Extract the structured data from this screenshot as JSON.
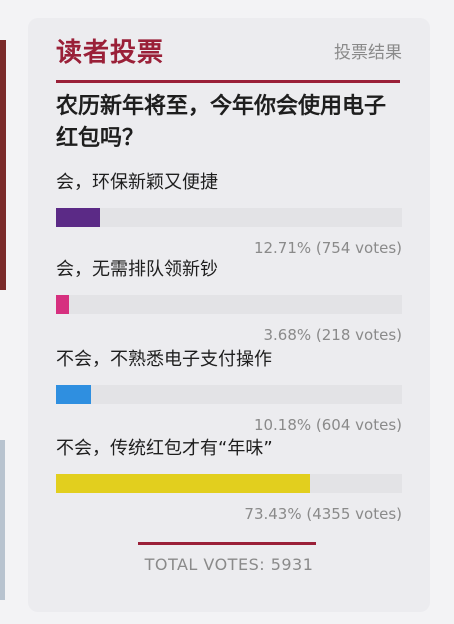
{
  "header": {
    "title": "读者投票",
    "results_link": "投票结果"
  },
  "question": "农历新年将至，今年你会使用电子红包吗？",
  "options": [
    {
      "label": "会，环保新颖又便捷",
      "percent": 12.71,
      "result_text": "12.71% (754 votes)",
      "color": "#5b2a86"
    },
    {
      "label": "会，无需排队领新钞",
      "percent": 3.68,
      "result_text": "3.68% (218 votes)",
      "color": "#d6307f"
    },
    {
      "label": "不会，不熟悉电子支付操作",
      "percent": 10.18,
      "result_text": "10.18% (604 votes)",
      "color": "#2f8fe0"
    },
    {
      "label": "不会，传统红包才有“年味”",
      "percent": 73.43,
      "result_text": "73.43% (4355 votes)",
      "color": "#e2cf1e"
    }
  ],
  "total_text": "TOTAL VOTES: 5931"
}
